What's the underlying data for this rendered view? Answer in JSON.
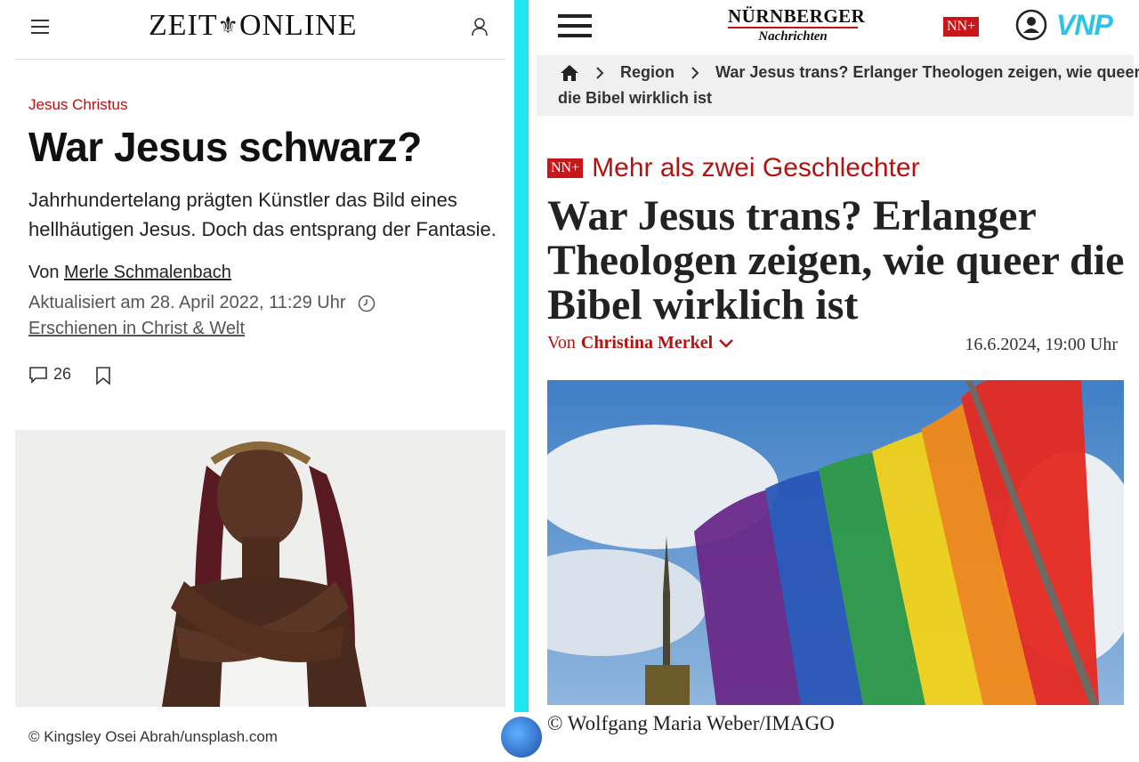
{
  "left": {
    "logo": "ZEIT",
    "logo_right": "ONLINE",
    "kicker": "Jesus Christus",
    "title": "War Jesus schwarz?",
    "lead": "Jahrhundertelang prägten Künstler das Bild eines hellhäutigen Jesus. Doch das entsprang der Fantasie.",
    "byline_prefix": "Von",
    "author": "Merle Schmalenbach",
    "updated": "Aktualisiert am 28. April 2022, 11:29 Uhr",
    "appeared": "Erschienen in Christ & Welt",
    "comment_count": "26",
    "photo_credit": "© Kingsley Osei Abrah/unsplash.com"
  },
  "right": {
    "logo_line1": "NÜRNBERGER",
    "logo_line2": "Nachrichten",
    "plus_badge": "NN+",
    "vnp_logo": "VNP",
    "breadcrumb_region": "Region",
    "breadcrumb_current": "War Jesus trans? Erlanger Theologen zeigen, wie queer die Bibel wirklich ist",
    "kicker": "Mehr als zwei Geschlechter",
    "title": "War Jesus trans? Erlanger Theologen zeigen, wie queer die Bibel wirklich ist",
    "byline_prefix": "Von",
    "author": "Christina Merkel",
    "date": "16.6.2024, 19:00 Uhr",
    "photo_credit": "© Wolfgang Maria Weber/IMAGO"
  }
}
